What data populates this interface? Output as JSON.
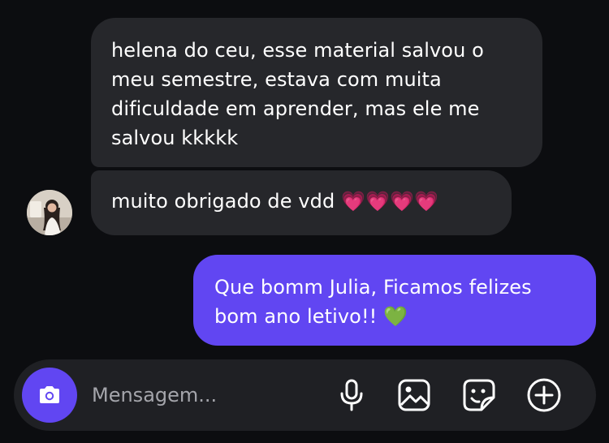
{
  "messages": [
    {
      "id": "msg1",
      "direction": "incoming",
      "text": "helena do ceu, esse material salvou o\nmeu semestre, estava com muita\ndificuldade em aprender, mas ele me\nsalvou kkkkk"
    },
    {
      "id": "msg2",
      "direction": "incoming",
      "text": "muito obrigado de vdd 💗💗💗💗"
    },
    {
      "id": "msg3",
      "direction": "outgoing",
      "text": "Que bomm Julia, Ficamos felizes\nbom ano letivo!! 💚"
    }
  ],
  "composer": {
    "placeholder": "Mensagem...",
    "value": ""
  },
  "icons": {
    "camera": "camera-icon",
    "mic": "microphone-icon",
    "gallery": "image-icon",
    "sticker": "sticker-icon",
    "add": "plus-circle-icon"
  },
  "colors": {
    "background": "#0c0d10",
    "incoming_bubble": "#26272b",
    "outgoing_bubble": "#6146f2",
    "accent": "#6146f2",
    "composer": "#1f2024",
    "placeholder": "#a4a5ab"
  }
}
